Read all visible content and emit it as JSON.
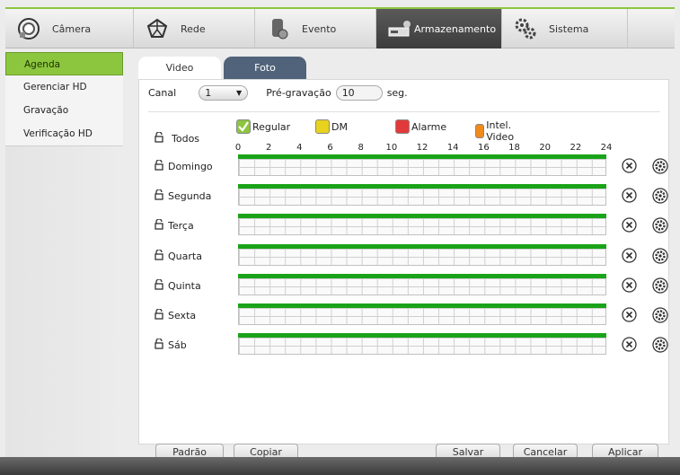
{
  "nav": {
    "tabs": [
      {
        "label": "Câmera",
        "icon": "camera-icon"
      },
      {
        "label": "Rede",
        "icon": "network-icon"
      },
      {
        "label": "Evento",
        "icon": "event-icon"
      },
      {
        "label": "Armazenamento",
        "icon": "storage-icon",
        "active": true
      },
      {
        "label": "Sistema",
        "icon": "gears-icon"
      }
    ]
  },
  "sidebar": {
    "items": [
      {
        "label": "Agenda",
        "active": true
      },
      {
        "label": "Gerenciar HD"
      },
      {
        "label": "Gravação"
      },
      {
        "label": "Verificação HD"
      }
    ]
  },
  "tabs": [
    {
      "label": "Video",
      "active": true
    },
    {
      "label": "Foto"
    }
  ],
  "settings": {
    "canal_label": "Canal",
    "canal_value": "1",
    "pre_label": "Pré-gravação",
    "pre_value": "10",
    "pre_unit": "seg."
  },
  "legend": [
    {
      "label": "Regular",
      "color": "#8cc63f",
      "checked": true
    },
    {
      "label": "DM",
      "color": "#e8d21d",
      "checked": false
    },
    {
      "label": "Alarme",
      "color": "#e23a3a",
      "checked": false
    },
    {
      "label": "Intel. Video",
      "color": "#f08a1a",
      "checked": false
    }
  ],
  "todos_label": "Todos",
  "hours": [
    "0",
    "2",
    "4",
    "6",
    "8",
    "10",
    "12",
    "14",
    "16",
    "18",
    "20",
    "22",
    "24"
  ],
  "days": [
    {
      "label": "Domingo"
    },
    {
      "label": "Segunda"
    },
    {
      "label": "Terça"
    },
    {
      "label": "Quarta"
    },
    {
      "label": "Quinta"
    },
    {
      "label": "Sexta"
    },
    {
      "label": "Sáb"
    }
  ],
  "schedule_color": "#1aa319",
  "buttons": {
    "padrao": "Padrão",
    "copiar": "Copiar",
    "salvar": "Salvar",
    "cancelar": "Cancelar",
    "aplicar": "Aplicar"
  }
}
